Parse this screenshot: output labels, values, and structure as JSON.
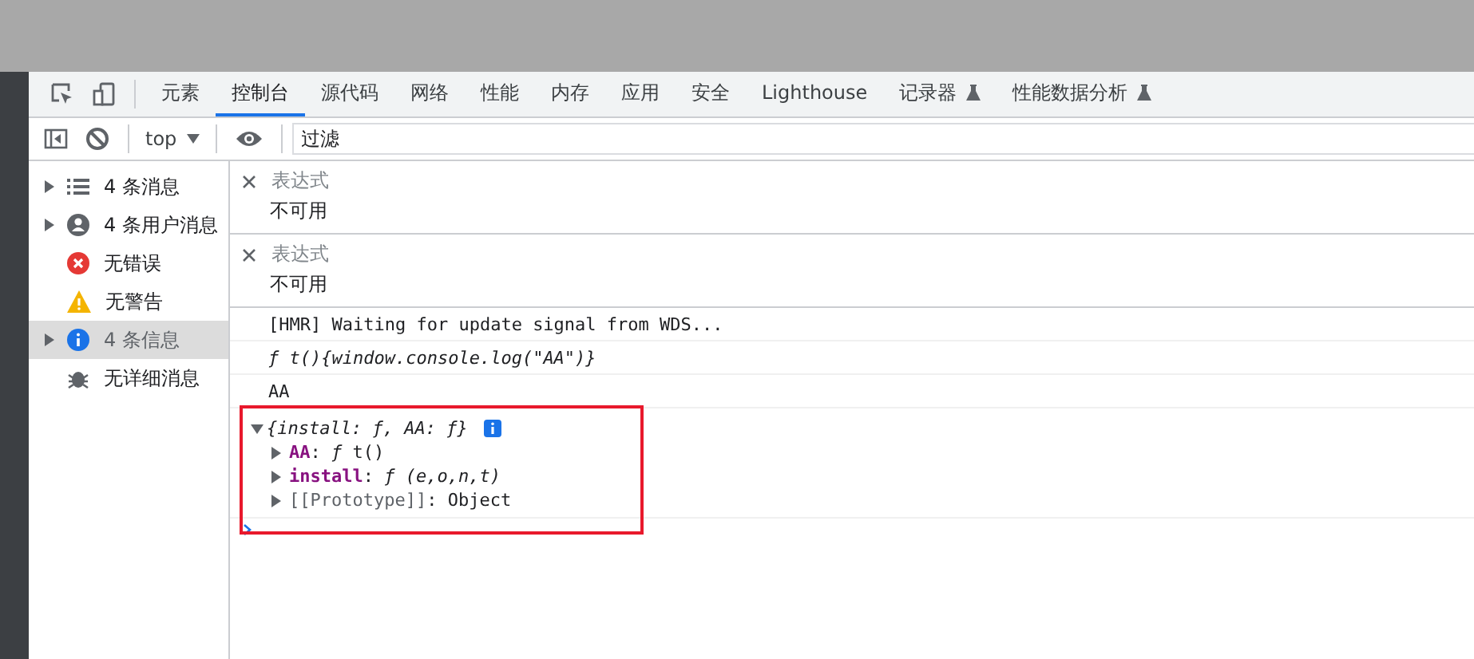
{
  "tabs": [
    {
      "label": "元素",
      "selected": false,
      "experimental": false
    },
    {
      "label": "控制台",
      "selected": true,
      "experimental": false
    },
    {
      "label": "源代码",
      "selected": false,
      "experimental": false
    },
    {
      "label": "网络",
      "selected": false,
      "experimental": false
    },
    {
      "label": "性能",
      "selected": false,
      "experimental": false
    },
    {
      "label": "内存",
      "selected": false,
      "experimental": false
    },
    {
      "label": "应用",
      "selected": false,
      "experimental": false
    },
    {
      "label": "安全",
      "selected": false,
      "experimental": false
    },
    {
      "label": "Lighthouse",
      "selected": false,
      "experimental": false
    },
    {
      "label": "记录器",
      "selected": false,
      "experimental": true
    },
    {
      "label": "性能数据分析",
      "selected": false,
      "experimental": true
    }
  ],
  "toolbar": {
    "context": "top",
    "filter": {
      "placeholder": "过滤"
    }
  },
  "sidebar": {
    "items": [
      {
        "label": "4 条消息",
        "kind": "list",
        "expandable": true,
        "selected": false
      },
      {
        "label": "4 条用户消息",
        "kind": "user",
        "expandable": true,
        "selected": false
      },
      {
        "label": "无错误",
        "kind": "error",
        "expandable": false,
        "selected": false
      },
      {
        "label": "无警告",
        "kind": "warning",
        "expandable": false,
        "selected": false
      },
      {
        "label": "4 条信息",
        "kind": "info",
        "expandable": true,
        "selected": true
      },
      {
        "label": "无详细消息",
        "kind": "verbose",
        "expandable": false,
        "selected": false
      }
    ]
  },
  "live_expressions": [
    {
      "expression": "表达式",
      "value": "不可用"
    },
    {
      "expression": "表达式",
      "value": "不可用"
    }
  ],
  "console": [
    {
      "kind": "text",
      "text": "[HMR] Waiting for update signal from WDS..."
    },
    {
      "kind": "function",
      "text": "*ƒ* t(){window.console.log(\"AA\")}"
    },
    {
      "kind": "text",
      "text": "AA"
    },
    {
      "kind": "object",
      "text": "{install: ƒ, AA: ƒ}",
      "expanded": true,
      "highlighted": true,
      "children": [
        {
          "kind": "own",
          "key": "AA",
          "value": ": *ƒ* t()",
          "expanded": false
        },
        {
          "kind": "own",
          "key": "install",
          "value": ": *ƒ (e,o,n,t)*",
          "expanded": false
        },
        {
          "kind": "internal",
          "key": "[[Prototype]]",
          "value": ": Object",
          "expanded": false
        }
      ]
    }
  ]
}
